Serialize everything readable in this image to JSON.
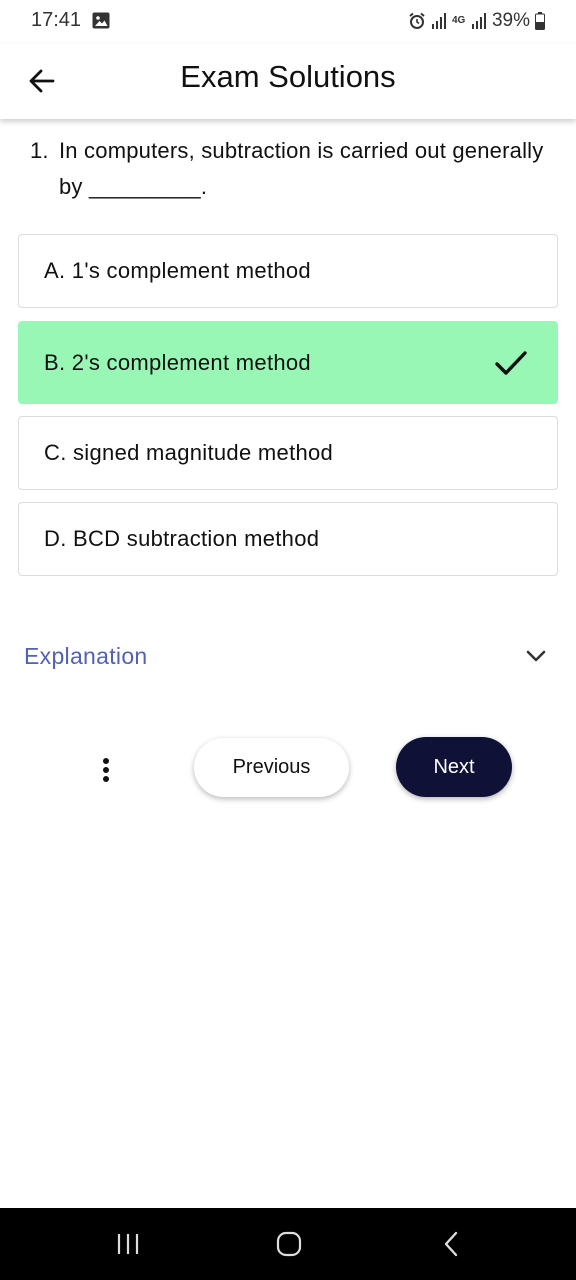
{
  "status_bar": {
    "time": "17:41",
    "battery": "39%",
    "network": "4G"
  },
  "app_bar": {
    "title": "Exam Solutions"
  },
  "question": {
    "number": "1.",
    "text": "In computers, subtraction is carried out generally by _________."
  },
  "options": [
    {
      "label": "A. 1's complement method",
      "correct": false
    },
    {
      "label": "B. 2's complement method",
      "correct": true
    },
    {
      "label": "C. signed magnitude method",
      "correct": false
    },
    {
      "label": "D. BCD subtraction method",
      "correct": false
    }
  ],
  "explanation": {
    "label": "Explanation"
  },
  "buttons": {
    "previous": "Previous",
    "next": "Next"
  },
  "colors": {
    "correct_bg": "#98f7b4",
    "accent": "#5361b5",
    "next_bg": "#0f1137"
  },
  "icons": [
    "gallery-icon",
    "alarm-icon",
    "signal-icon",
    "battery-icon",
    "back-arrow-icon",
    "check-icon",
    "chevron-down-icon",
    "more-vert-icon",
    "recents-icon",
    "home-icon",
    "nav-back-icon"
  ]
}
